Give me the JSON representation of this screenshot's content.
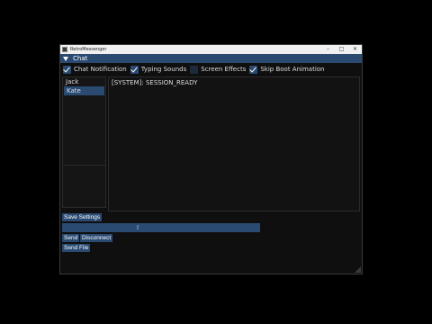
{
  "window": {
    "title": "RetroMessenger",
    "minimize": "–",
    "maximize": "□",
    "close": "✕"
  },
  "menu": {
    "label": "Chat"
  },
  "settings": [
    {
      "label": "Chat Notification",
      "checked": true
    },
    {
      "label": "Typing Sounds",
      "checked": true
    },
    {
      "label": "Screen Effects",
      "checked": false
    },
    {
      "label": "Skip Boot Animation",
      "checked": true
    }
  ],
  "contacts": [
    {
      "name": "Jack",
      "selected": false
    },
    {
      "name": "Kate",
      "selected": true
    }
  ],
  "log": {
    "lines": [
      "[SYSTEM]: SESSION_READY"
    ]
  },
  "buttons": {
    "save_settings": "Save Settings",
    "send": "Send",
    "disconnect": "Disconnect",
    "send_file": "Send File"
  },
  "input": {
    "value": "",
    "cursor": "I"
  },
  "colors": {
    "accent": "#2a4a72",
    "background": "#0f0f0f",
    "text": "#dddddd"
  }
}
